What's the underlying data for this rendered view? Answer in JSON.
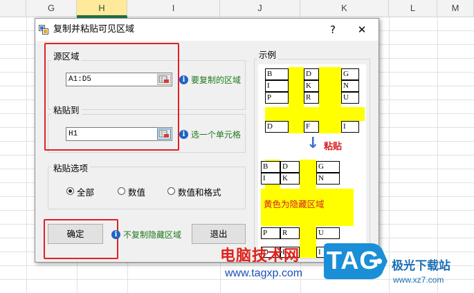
{
  "sheet": {
    "columns": [
      "G",
      "H",
      "I",
      "J",
      "K",
      "L",
      "M"
    ],
    "selected_column": "H"
  },
  "dialog": {
    "title": "复制并粘贴可见区域",
    "help_label": "?",
    "close_label": "✕",
    "source": {
      "group_label": "源区域",
      "value": "A1:D5",
      "hint": "要复制的区域",
      "info_glyph": "i"
    },
    "paste_to": {
      "group_label": "粘贴到",
      "value": "H1",
      "hint": "选一个单元格",
      "info_glyph": "i"
    },
    "options": {
      "group_label": "粘贴选项",
      "items": [
        {
          "label": "全部",
          "selected": true
        },
        {
          "label": "数值",
          "selected": false
        },
        {
          "label": "数值和格式",
          "selected": false
        }
      ]
    },
    "ok_label": "确定",
    "no_hidden_hint": "不复制隐藏区域",
    "no_hidden_info": "i",
    "exit_label": "退出",
    "example": {
      "group_label": "示例",
      "top_cells": {
        "row1": [
          "B",
          "D",
          "G"
        ],
        "row2": [
          "I",
          "K",
          "N"
        ],
        "row3": [
          "P",
          "R",
          "U"
        ],
        "row4": [
          "D",
          "F",
          "I"
        ]
      },
      "arrow_glyph": "↓",
      "paste_label": "粘贴",
      "bottom_cells": {
        "row1": [
          "B",
          "D",
          "G"
        ],
        "row2": [
          "I",
          "K",
          "N"
        ],
        "row3": [
          "P",
          "R",
          "U"
        ],
        "row4": [
          "D",
          "F",
          "I"
        ]
      },
      "hidden_caption": "黄色为隐藏区域"
    }
  },
  "watermark": {
    "site_name": "电脑技术网",
    "site_url": "www.tagxp.com",
    "tag_logo": "TAG",
    "brand_cn": "极光下载站",
    "brand_url": "www.xz7.com"
  },
  "colors": {
    "accent_red": "#e02020",
    "hint_green": "#1f7a1f",
    "hidden_yellow": "#ffff00",
    "tag_blue": "#1a8fd8"
  }
}
